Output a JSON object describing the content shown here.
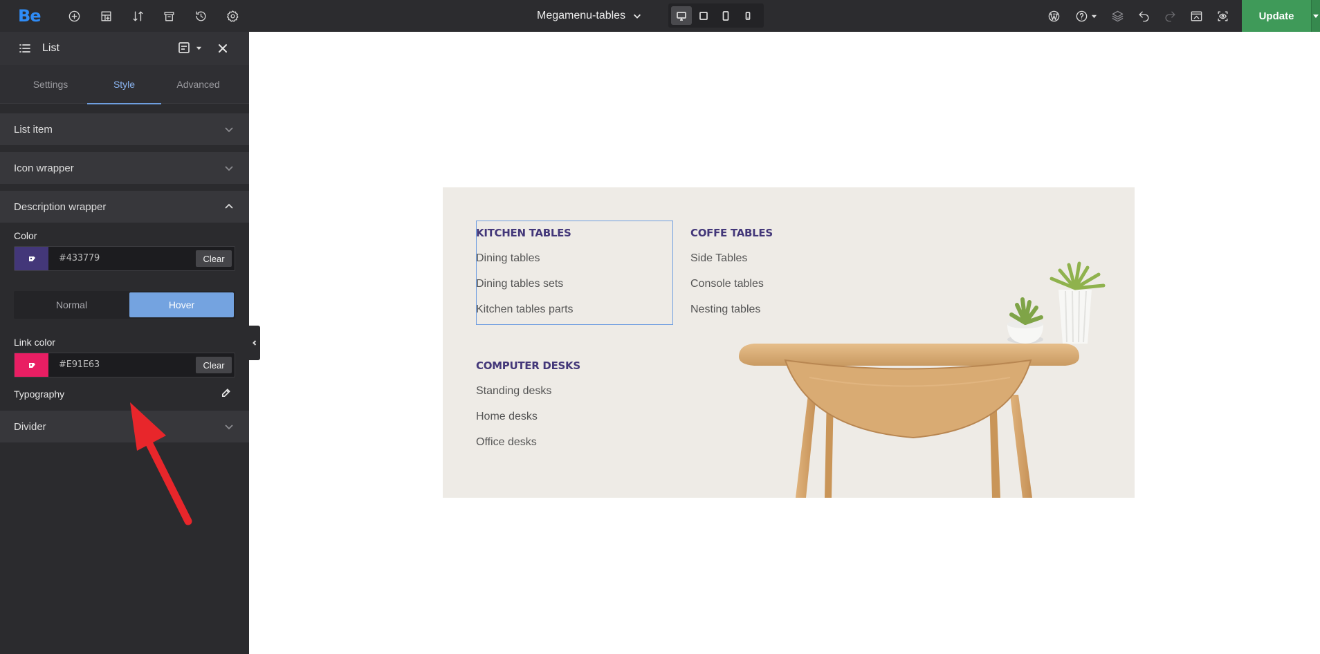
{
  "topbar": {
    "logo": "Be",
    "page_title": "Megamenu-tables",
    "update_label": "Update",
    "icons": [
      "add-icon",
      "layout-icon",
      "sort-icon",
      "template-icon",
      "history-icon",
      "settings-icon",
      "wordpress-icon",
      "help-icon",
      "layers-icon",
      "undo-icon",
      "redo-icon",
      "preview-icon",
      "eye-icon"
    ],
    "devices": [
      "desktop-icon",
      "laptop-icon",
      "tablet-icon",
      "mobile-icon"
    ],
    "active_device": "desktop"
  },
  "sidebar": {
    "title": "List",
    "tabs": [
      "Settings",
      "Style",
      "Advanced"
    ],
    "active_tab": "Style",
    "sections": {
      "list_item": "List item",
      "icon_wrapper": "Icon wrapper",
      "description_wrapper": "Description wrapper",
      "divider": "Divider"
    },
    "color_label": "Color",
    "color_value": "#433779",
    "clear_label": "Clear",
    "states": [
      "Normal",
      "Hover"
    ],
    "active_state": "Hover",
    "link_color_label": "Link color",
    "link_color_value": "#E91E63",
    "typography_label": "Typography"
  },
  "megamenu": {
    "columns": [
      {
        "heading": "KITCHEN TABLES",
        "items": [
          "Dining tables",
          "Dining tables sets",
          "Kitchen tables parts"
        ]
      },
      {
        "heading": "COFFE TABLES",
        "items": [
          "Side Tables",
          "Console tables",
          "Nesting tables"
        ]
      },
      {
        "heading": "COMPUTER DESKS",
        "items": [
          "Standing desks",
          "Home desks",
          "Office desks"
        ]
      }
    ]
  },
  "colors": {
    "accent": "#74a3e0",
    "update_green": "#3f9a59",
    "heading_purple": "#433779",
    "link_pink": "#E91E63",
    "annotation_red": "#e8262b"
  }
}
